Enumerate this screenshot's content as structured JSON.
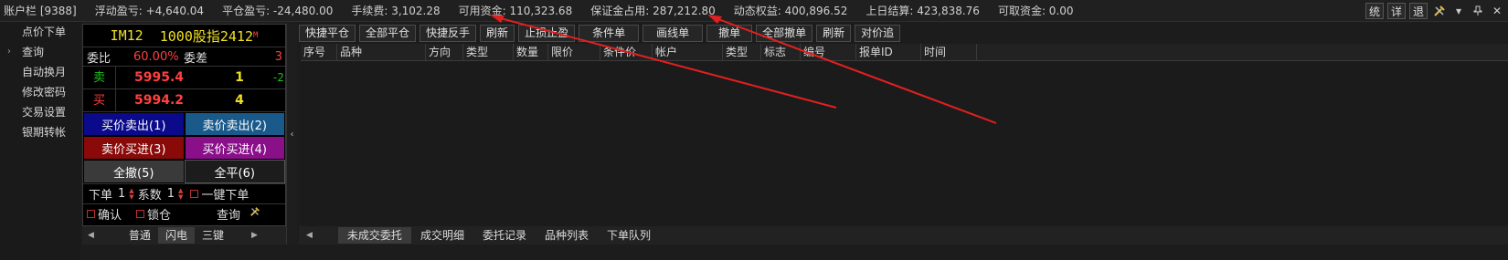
{
  "topbar": {
    "account": "账户栏 [9388]",
    "float_pnl": "浮动盈亏: +4,640.04",
    "close_pnl": "平仓盈亏: -24,480.00",
    "fee": "手续费: 3,102.28",
    "available": "可用资金: 110,323.68",
    "margin": "保证金占用: 287,212.80",
    "equity": "动态权益: 400,896.52",
    "prev_settle": "上日结算: 423,838.76",
    "withdrawable": "可取资金: 0.00",
    "btn_tong": "统",
    "btn_xiang": "详",
    "btn_tui": "退"
  },
  "sidebar": {
    "items": [
      {
        "label": "点价下单"
      },
      {
        "label": "查询"
      },
      {
        "label": "自动换月"
      },
      {
        "label": "修改密码"
      },
      {
        "label": "交易设置"
      },
      {
        "label": "银期转帐"
      }
    ]
  },
  "panel": {
    "contract": "IM12",
    "contract_name": "1000股指2412",
    "contract_mark": "M",
    "ratio_label": "委比",
    "ratio_value": "60.00%",
    "diff_label": "委差",
    "diff_value": "3",
    "sell_label": "卖",
    "sell_price": "5995.4",
    "sell_vol": "1",
    "sell_chg": "-2",
    "buy_label": "买",
    "buy_price": "5994.2",
    "buy_vol": "4",
    "btn_buy_sell": "买价卖出(1)",
    "btn_sell_sell": "卖价卖出(2)",
    "btn_sell_buy": "卖价买进(3)",
    "btn_buy_buy": "买价买进(4)",
    "btn_cancel_all": "全撤(5)",
    "btn_close_all": "全平(6)",
    "order_label": "下单",
    "order_qty": "1",
    "coef_label": "系数",
    "coef_value": "1",
    "one_click_label": "一键下单",
    "confirm_label": "确认",
    "lock_label": "锁仓",
    "query_label": "查询"
  },
  "panel_tabs": [
    "普通",
    "闪电",
    "三键"
  ],
  "toolbar": [
    "快捷平仓",
    "全部平仓",
    "快捷反手",
    "刷新",
    "止损止盈",
    "条件单",
    "画线单",
    "撤单",
    "全部撤单",
    "刷新",
    "对价追"
  ],
  "table": {
    "columns": [
      "序号",
      "品种",
      "方向",
      "类型",
      "数量",
      "限价",
      "条件价",
      "帐户",
      "类型",
      "标志",
      "编号",
      "报单ID",
      "时间"
    ]
  },
  "bottom_tabs": [
    "未成交委托",
    "成交明细",
    "委托记录",
    "品种列表",
    "下单队列"
  ],
  "colors": {
    "red": "#ff4040",
    "yellow": "#f0e020",
    "green": "#20c020",
    "btn_blue_dark": "#0a0a8a",
    "btn_blue_light": "#1a5a8a",
    "btn_red": "#8a0a0a",
    "btn_purple": "#8a108a",
    "btn_gray": "#3a3a3a",
    "arrow": "#e02020"
  }
}
